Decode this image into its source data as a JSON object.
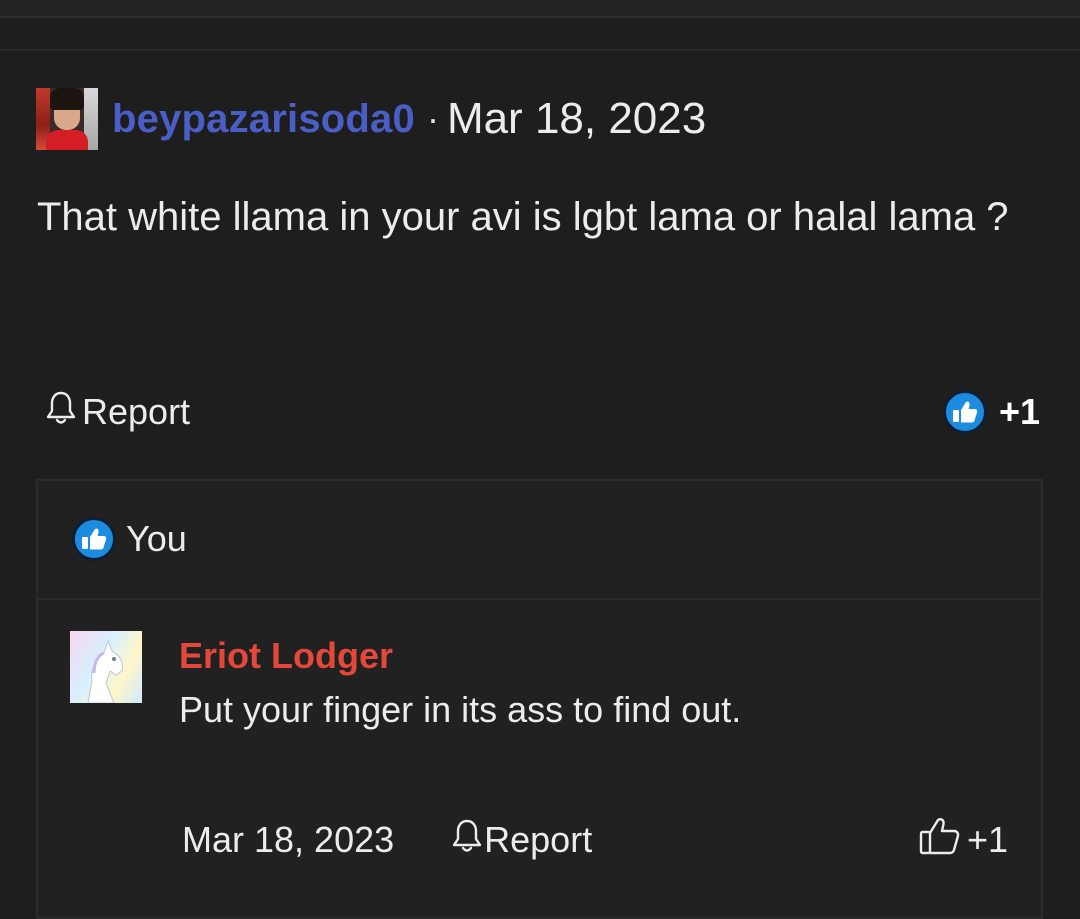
{
  "post": {
    "author": "beypazarisoda0",
    "separator": "·",
    "date": "Mar 18, 2023",
    "body": "That white llama in your avi is lgbt lama or halal lama ?",
    "report_label": "Report",
    "reaction_count": "+1",
    "like_icon": "thumbs-up-icon",
    "report_icon": "bell-icon"
  },
  "likers": {
    "name": "You"
  },
  "reply": {
    "author": "Eriot Lodger",
    "text": "Put your finger in its ass to find out.",
    "date": "Mar 18, 2023",
    "report_label": "Report",
    "like_count": "+1"
  },
  "colors": {
    "background": "#1e1e1e",
    "username": "#4a5ec6",
    "reply_author": "#e5483a",
    "like_blue": "#1d8ce0",
    "text": "#ececec"
  }
}
